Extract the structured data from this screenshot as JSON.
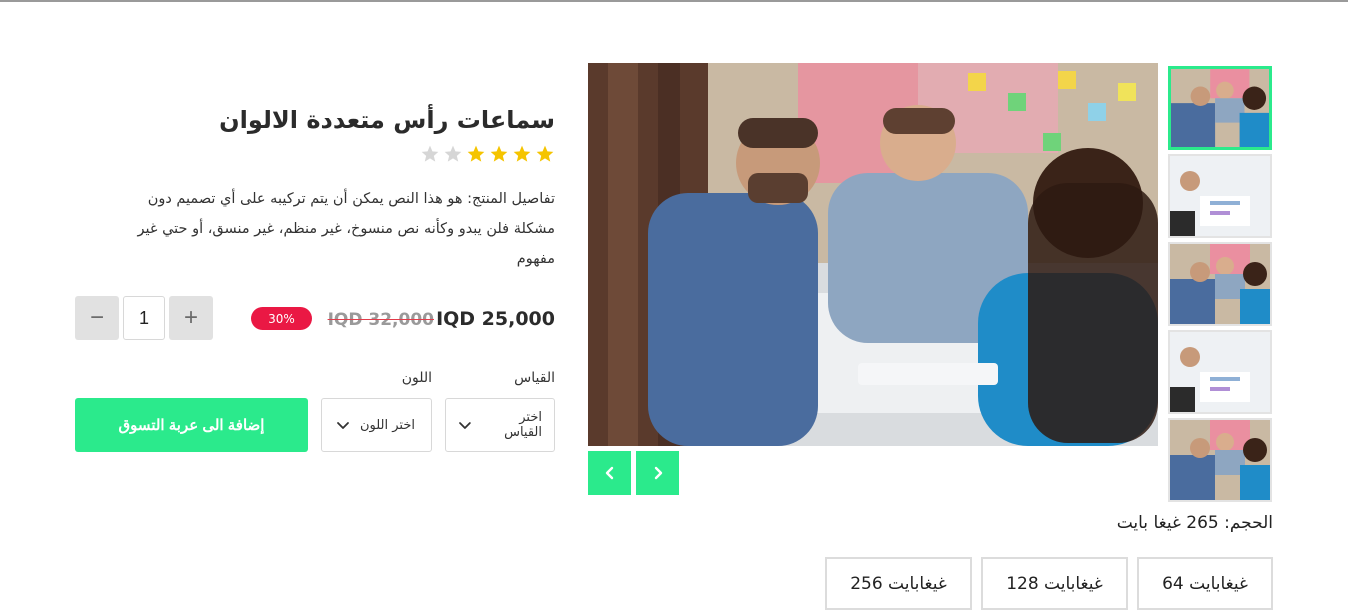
{
  "product": {
    "title": "سماعات رأس متعددة الالوان",
    "rating": {
      "value": 4,
      "max": 6
    },
    "description": "تفاصيل المنتج: هو هذا النص يمكن أن يتم تركيبه على أي تصميم دون مشكلة فلن يبدو وكأنه نص منسوخ، غير منظم، غير منسق، أو حتي غير مفهوم",
    "price": "IQD 25,000",
    "old_price": "IQD 32,000",
    "discount_badge": "30%"
  },
  "quantity": {
    "value": "1",
    "minus_label": "−",
    "plus_label": "+"
  },
  "options": {
    "size_label": "القياس",
    "color_label": "اللون",
    "size_placeholder": "اختر القياس",
    "color_placeholder": "اختر اللون"
  },
  "add_to_cart_label": "إضافة الى عربة التسوق",
  "gallery": {
    "main_image": "photo-people-meeting",
    "thumbnail_count": 5,
    "active_thumbnail": 1,
    "prev_icon": "chevron-left-icon",
    "next_icon": "chevron-right-icon"
  },
  "storage": {
    "selected_text": "الحجم: 265 غيغا بايت",
    "options": [
      "64 غيغابايت",
      "128 غيغابايت",
      "256 غيغابايت"
    ]
  },
  "colors": {
    "accent": "#2bea8c",
    "badge": "#ea1844",
    "star_filled": "#f5c400",
    "star_empty": "#d6d6d6"
  }
}
